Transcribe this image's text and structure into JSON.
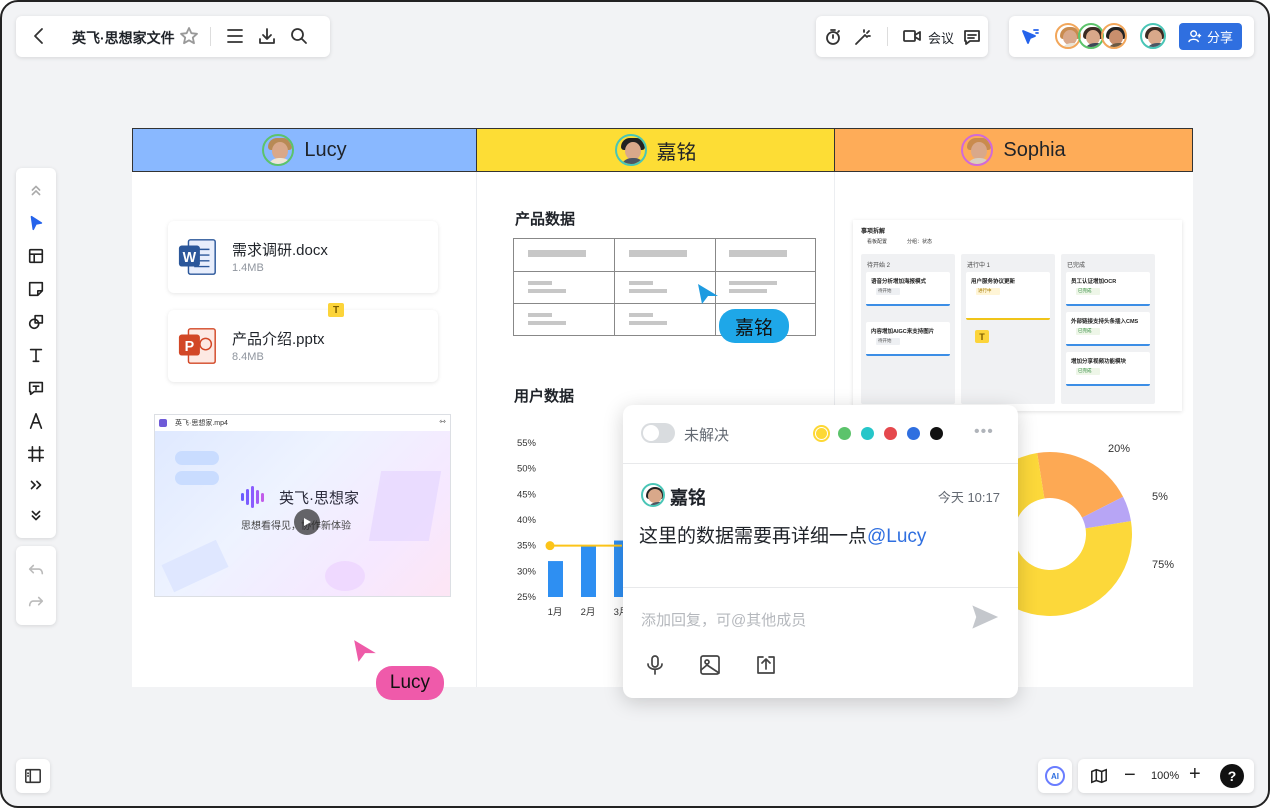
{
  "toolbar": {
    "doc_title": "英飞·思想家文件",
    "meeting_label": "会议",
    "share_label": "分享"
  },
  "board": {
    "columns": [
      {
        "name": "Lucy",
        "color": "#89b8ff"
      },
      {
        "name": "嘉铭",
        "color": "#fddd35"
      },
      {
        "name": "Sophia",
        "color": "#feac58"
      }
    ],
    "files": [
      {
        "name": "需求调研.docx",
        "size": "1.4MB",
        "type": "word"
      },
      {
        "name": "产品介绍.pptx",
        "size": "8.4MB",
        "type": "ppt"
      }
    ],
    "video": {
      "filename": "英飞·思想家.mp4",
      "brand": "英飞·思想家",
      "tagline": "思想看得见，协作新体验"
    },
    "product_data_title": "产品数据",
    "user_data_title": "用户数据",
    "cursors": {
      "jiaming": "嘉铭",
      "lucy": "Lucy"
    }
  },
  "chart_data": [
    {
      "type": "bar",
      "categories": [
        "1月",
        "2月",
        "3月"
      ],
      "values": [
        32,
        35,
        36
      ],
      "ytick_labels": [
        "55%",
        "50%",
        "45%",
        "40%",
        "35%",
        "30%",
        "25%"
      ],
      "ylim": [
        25,
        55
      ],
      "line_marker_value": 35
    },
    {
      "type": "pie",
      "slices": [
        {
          "label": "20%",
          "value": 20,
          "color": "#fda954"
        },
        {
          "label": "5%",
          "value": 5,
          "color": "#b7a5f5"
        },
        {
          "label": "75%",
          "value": 75,
          "color": "#fcd83a"
        }
      ]
    }
  ],
  "kanban": {
    "title": "事项拆解",
    "filter_label": "看板配置",
    "group_label": "分组：状态",
    "columns": [
      {
        "title": "待开始 2",
        "cards": [
          "语音分析增加海报模式",
          "内容增加AIGC来支持图片"
        ],
        "tag": "待开始"
      },
      {
        "title": "进行中 1",
        "cards": [
          "用户服务协议更新"
        ],
        "tag": "进行中"
      },
      {
        "title": "已完成",
        "cards": [
          "员工认证增加OCR",
          "外部链接支持头条插入CMS",
          "增加分享视频功能模块"
        ],
        "tag": "已完成"
      }
    ]
  },
  "comment": {
    "status_label": "未解决",
    "author": "嘉铭",
    "time": "今天 10:17",
    "body_text": "这里的数据需要再详细一点",
    "mention": "@Lucy",
    "reply_placeholder": "添加回复，可@其他成员",
    "colors": [
      "#fdd835",
      "#5cc36b",
      "#26c6c9",
      "#e5484d",
      "#2f6fe0",
      "#111111"
    ]
  },
  "bottom": {
    "zoom": "100%",
    "ai_label": "AI"
  }
}
